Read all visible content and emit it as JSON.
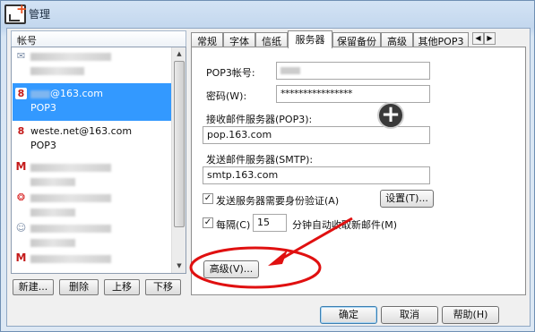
{
  "window": {
    "title": "管理"
  },
  "left": {
    "header": "帐号",
    "accounts": [
      {
        "name": "",
        "type": "",
        "icon": "mail-icon",
        "selected": false
      },
      {
        "name": "@163.com",
        "type": "POP3",
        "icon": "netease-163-icon",
        "selected": true
      },
      {
        "name": "weste.net@163.com",
        "type": "POP3",
        "icon": "netease-163-icon",
        "selected": false
      },
      {
        "name": "",
        "type": "",
        "icon": "gmail-icon",
        "selected": false
      },
      {
        "name": "",
        "type": "",
        "icon": "sina-icon",
        "selected": false
      },
      {
        "name": "",
        "type": "",
        "icon": "qq-icon",
        "selected": false
      },
      {
        "name": "",
        "type": "",
        "icon": "gmail-icon",
        "selected": false
      }
    ],
    "buttons": {
      "new": "新建...",
      "delete": "删除",
      "up": "上移",
      "down": "下移"
    }
  },
  "tabs": [
    "常规",
    "字体",
    "信纸",
    "服务器",
    "保留备份",
    "高级",
    "其他POP3"
  ],
  "active_tab": "服务器",
  "server": {
    "pop3_account_label": "POP3帐号:",
    "password_label": "密码(W):",
    "password_value": "****************",
    "incoming_label": "接收邮件服务器(POP3):",
    "incoming_value": "pop.163.com",
    "outgoing_label": "发送邮件服务器(SMTP):",
    "outgoing_value": "smtp.163.com",
    "auth_label": "发送服务器需要身份验证(A)",
    "auth_checked": true,
    "settings_button": "设置(T)...",
    "interval_label": "每隔(C)",
    "interval_checked": true,
    "interval_value": "15",
    "interval_suffix": "分钟自动收取新邮件(M)",
    "advanced_button": "高级(V)..."
  },
  "footer": {
    "ok": "确定",
    "cancel": "取消",
    "help": "帮助(H)"
  },
  "colors": {
    "selection": "#3399ff",
    "annotation": "#e01010"
  }
}
